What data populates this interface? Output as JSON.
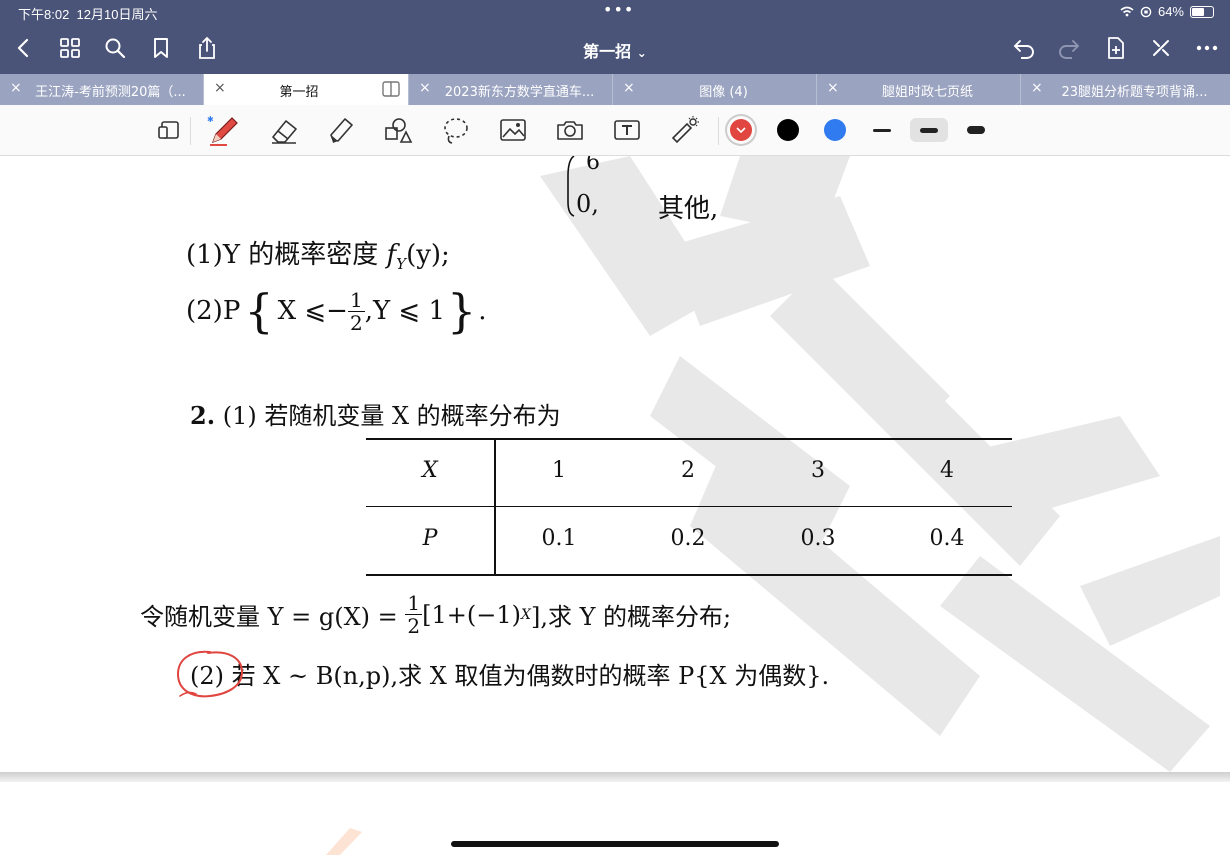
{
  "status_bar": {
    "time": "下午8:02",
    "date": "12月10日周六",
    "dots": "•••",
    "battery": "64%",
    "battery_level": 0.64
  },
  "nav": {
    "title": "第一招",
    "title_chevron": "⌄"
  },
  "tabs": [
    {
      "label": "王江涛-考前预测20篇（...",
      "active": false
    },
    {
      "label": "第一招",
      "active": true
    },
    {
      "label": "2023新东方数学直通车...",
      "active": false
    },
    {
      "label": "图像 (4)",
      "active": false
    },
    {
      "label": "腿姐时政七页纸",
      "active": false
    },
    {
      "label": "23腿姐分析题专项背诵...",
      "active": false
    }
  ],
  "tools": [
    "page-layout-icon",
    "pen-icon",
    "eraser-icon",
    "highlighter-icon",
    "shapes-icon",
    "lasso-icon",
    "image-icon",
    "camera-icon",
    "text-box-icon",
    "laser-pointer-icon"
  ],
  "colors": {
    "selected": "#e0453f",
    "black": "#000000",
    "blue": "#2f7bef",
    "topbar": "#4a5478"
  },
  "doc": {
    "frag_6": "6",
    "frag_0": "0,",
    "frag_other": "其他,",
    "q1_label": "(1)",
    "q1_text": "Y 的概率密度",
    "q1_formula": "f",
    "q1_sub": "Y",
    "q1_arg": "(y);",
    "q2_prefix": "(2)P",
    "q2_body_a": "X ⩽−",
    "q2_frac_num": "1",
    "q2_frac_den": "2",
    "q2_body_b": ",Y ⩽ 1",
    "q2_end": ".",
    "p2_num": "2.",
    "p2_text": "(1) 若随机变量 X 的概率分布为",
    "table": {
      "header_x": "X",
      "header_p": "P",
      "x_values": [
        "1",
        "2",
        "3",
        "4"
      ],
      "p_values": [
        "0.1",
        "0.2",
        "0.3",
        "0.4"
      ]
    },
    "line3_a": "令随机变量 Y = g(X) =",
    "line3_frac_num": "1",
    "line3_frac_den": "2",
    "line3_b": "[1+(−1)",
    "line3_sup": "X",
    "line3_c": "],求 Y 的概率分布;",
    "line4_label": "(2)",
    "line4_text": "若 X ~ B(n,p),求 X 取值为偶数时的概率 P{X 为偶数}."
  }
}
